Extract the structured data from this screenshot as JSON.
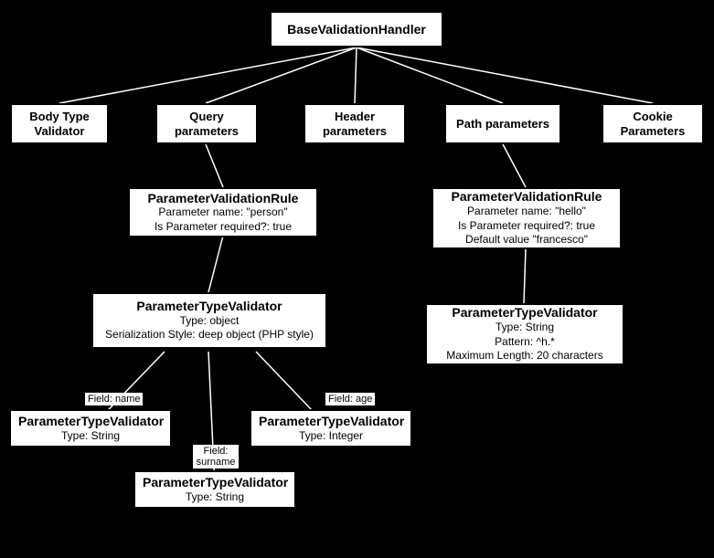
{
  "root": {
    "title": "BaseValidationHandler"
  },
  "row2": {
    "body": {
      "l1": "Body Type",
      "l2": "Validator"
    },
    "query": {
      "l1": "Query",
      "l2": "parameters"
    },
    "header": {
      "l1": "Header",
      "l2": "parameters"
    },
    "path": {
      "l1": "Path parameters"
    },
    "cookie": {
      "l1": "Cookie",
      "l2": "Parameters"
    }
  },
  "rule_person": {
    "title": "ParameterValidationRule",
    "a1": "Parameter name: \"person\"",
    "a2": "Is Parameter required?: true"
  },
  "rule_hello": {
    "title": "ParameterValidationRule",
    "a1": "Parameter name: \"hello\"",
    "a2": "Is Parameter required?: true",
    "a3": "Default value \"francesco\""
  },
  "tv_object": {
    "title": "ParameterTypeValidator",
    "a1": "Type: object",
    "a2": "Serialization Style: deep object (PHP style)"
  },
  "tv_string": {
    "title": "ParameterTypeValidator",
    "a1": "Type: String",
    "a2": "Pattern: ^h.*",
    "a3": "Maximum Length: 20 characters"
  },
  "tv_name": {
    "title": "ParameterTypeValidator",
    "a1": "Type: String"
  },
  "tv_age": {
    "title": "ParameterTypeValidator",
    "a1": "Type: Integer"
  },
  "tv_surname": {
    "title": "ParameterTypeValidator",
    "a1": "Type: String"
  },
  "labels": {
    "name": "Field: name",
    "age": "Field: age",
    "surname1": "Field:",
    "surname2": "surname"
  }
}
